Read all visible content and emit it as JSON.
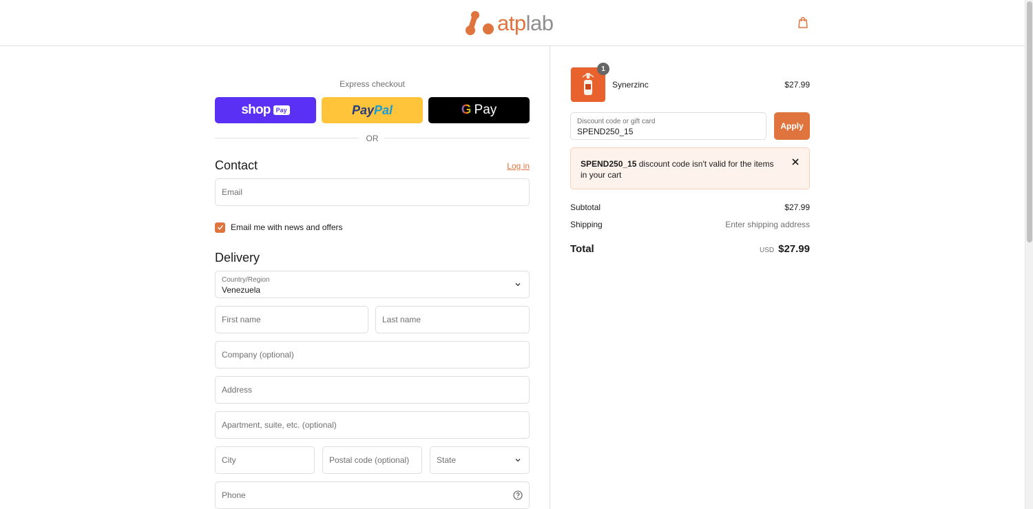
{
  "header": {
    "logo_text_a": "atp",
    "logo_text_b": "lab",
    "cart_icon": "shopping-bag-icon"
  },
  "express": {
    "label": "Express checkout",
    "shop_label": "shop",
    "shop_pay_badge": "Pay",
    "paypal_a": "Pay",
    "paypal_b": "Pal",
    "gpay_g": "G",
    "gpay_label": "Pay",
    "or_label": "OR"
  },
  "contact": {
    "title": "Contact",
    "login_label": "Log in",
    "email_placeholder": "Email",
    "newsletter_label": "Email me with news and offers",
    "newsletter_checked": true
  },
  "delivery": {
    "title": "Delivery",
    "country_label": "Country/Region",
    "country_value": "Venezuela",
    "first_name_placeholder": "First name",
    "last_name_placeholder": "Last name",
    "company_placeholder": "Company (optional)",
    "address_placeholder": "Address",
    "apartment_placeholder": "Apartment, suite, etc. (optional)",
    "city_placeholder": "City",
    "postal_placeholder": "Postal code (optional)",
    "state_placeholder": "State",
    "phone_placeholder": "Phone"
  },
  "summary": {
    "product": {
      "name": "Synerzinc",
      "price": "$27.99",
      "quantity": "1"
    },
    "discount_label": "Discount code or gift card",
    "discount_value": "SPEND250_15",
    "apply_label": "Apply",
    "error_code": "SPEND250_15",
    "error_message": " discount code isn't valid for the items in your cart",
    "subtotal_label": "Subtotal",
    "subtotal_value": "$27.99",
    "shipping_label": "Shipping",
    "shipping_value": "Enter shipping address",
    "total_label": "Total",
    "total_currency": "USD",
    "total_value": "$27.99"
  },
  "colors": {
    "accent": "#e0743f",
    "shop_pay": "#5a31f4",
    "paypal": "#ffc439",
    "gpay": "#000000",
    "error_bg": "#fdf2ec"
  }
}
